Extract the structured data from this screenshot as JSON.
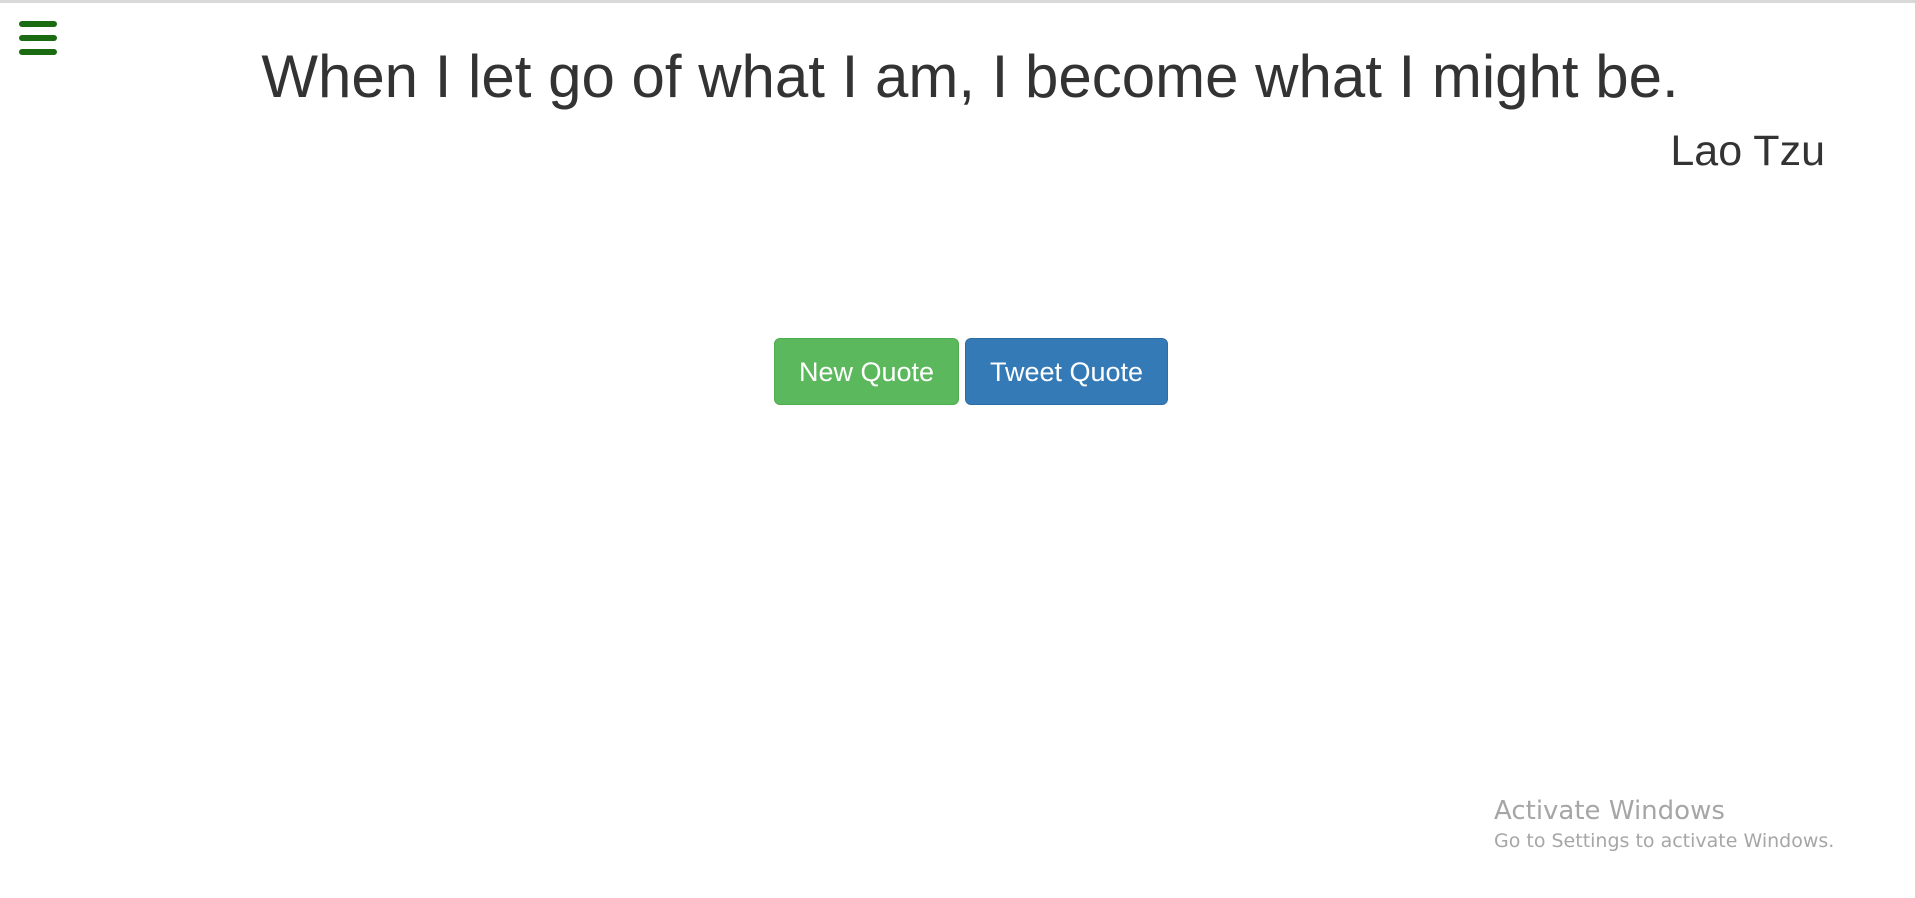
{
  "app": {
    "menu_icon": "hamburger-menu-icon",
    "menu_color": "#1a6b12"
  },
  "quote": {
    "text": "When I let go of what I am, I become what I might be.",
    "author": "Lao Tzu"
  },
  "buttons": {
    "new_quote": "New Quote",
    "tweet_quote": "Tweet Quote",
    "new_color": "#5cb85c",
    "tweet_color": "#337ab7"
  },
  "watermark": {
    "title": "Activate Windows",
    "subtitle": "Go to Settings to activate Windows."
  }
}
